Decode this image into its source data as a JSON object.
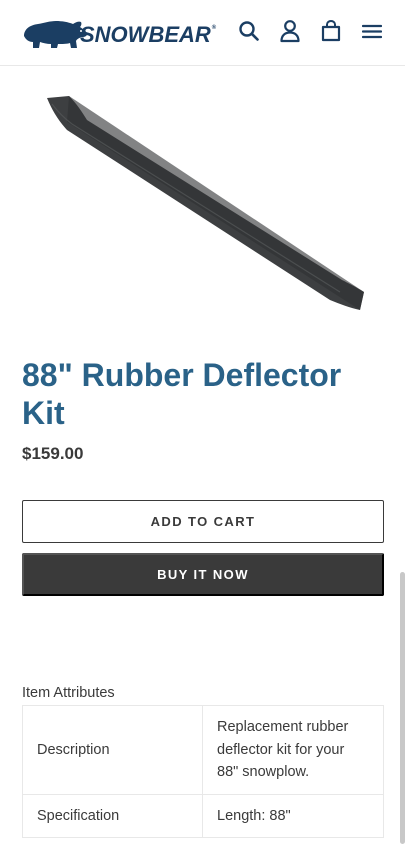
{
  "header": {
    "brand": "SNOWBEAR",
    "brand_mark": "®",
    "icons": [
      "search-icon",
      "account-icon",
      "cart-icon",
      "menu-icon"
    ]
  },
  "product": {
    "title": "88\" Rubber Deflector Kit",
    "price": "$159.00",
    "add_to_cart_label": "ADD TO CART",
    "buy_now_label": "BUY IT NOW"
  },
  "attributes": {
    "heading": "Item Attributes",
    "rows": [
      {
        "key": "Description",
        "value": "Replacement rubber deflector kit for your 88\" snowplow."
      },
      {
        "key": "Specification",
        "value": "Length: 88\""
      }
    ]
  },
  "colors": {
    "brand_navy": "#1b3e63",
    "title_blue": "#2a6288",
    "text_dark": "#3a3a3a",
    "button_dark": "#3a3a3a"
  }
}
